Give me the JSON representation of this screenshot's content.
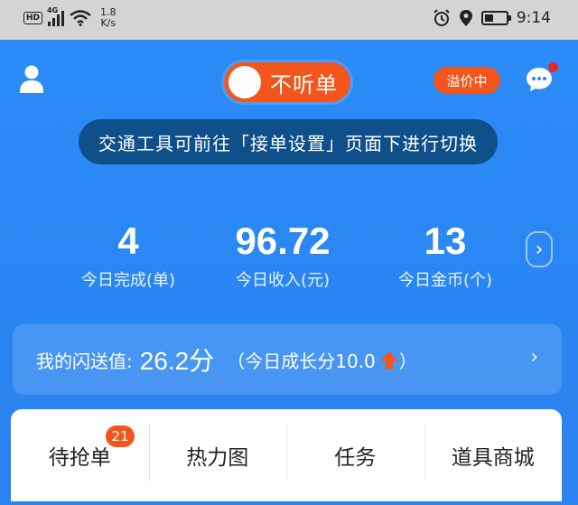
{
  "status_bar": {
    "hd": "HD",
    "network": "4G",
    "speed_value": "1.8",
    "speed_unit": "K/s",
    "time": "9:14",
    "icons": [
      "hd-icon",
      "signal-icon",
      "wifi-icon",
      "alarm-icon",
      "location-icon",
      "battery-icon"
    ]
  },
  "header": {
    "toggle_label": "不听单",
    "premium_badge": "溢价中",
    "tooltip": "交通工具可前往「接单设置」页面下进行切换"
  },
  "stats": [
    {
      "value": "4",
      "label": "今日完成(单)"
    },
    {
      "value": "96.72",
      "label": "今日收入(元)"
    },
    {
      "value": "13",
      "label": "今日金币(个)"
    }
  ],
  "score": {
    "label": "我的闪送值:",
    "value": "26.2分",
    "daily_growth": "（今日成长分10.0",
    "daily_close": "）"
  },
  "tabs": [
    {
      "label": "待抢单",
      "badge": "21"
    },
    {
      "label": "热力图"
    },
    {
      "label": "任务"
    },
    {
      "label": "道具商城"
    }
  ],
  "colors": {
    "primary": "#2a86f2",
    "accent": "#f2561d",
    "tooltip_bg": "#0f4f8a",
    "status_bar": "#d4d4d4",
    "notification_dot": "#e8262a"
  }
}
